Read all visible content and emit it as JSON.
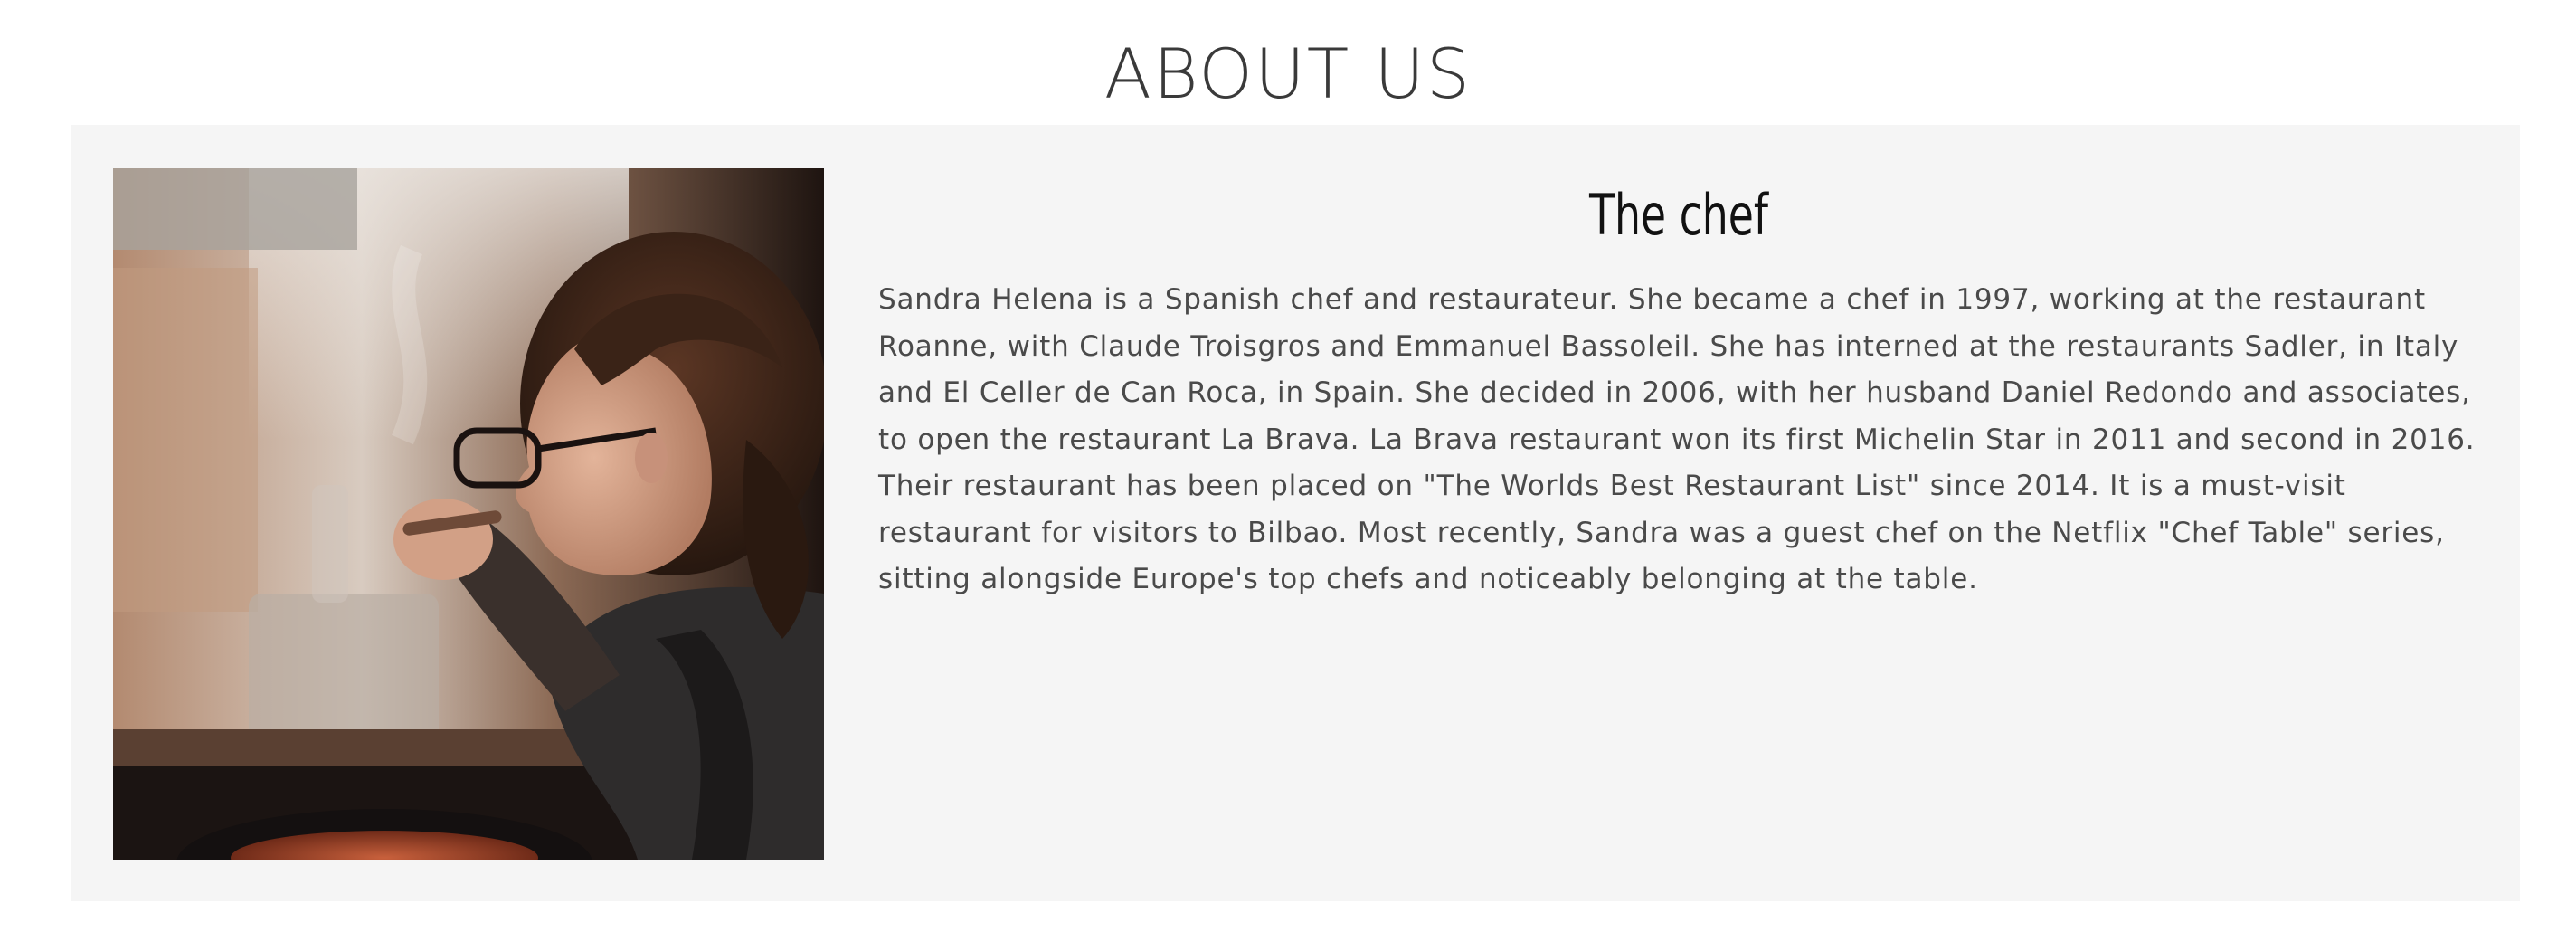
{
  "page": {
    "title": "ABOUT US"
  },
  "about": {
    "heading": "The chef",
    "bio": "Sandra Helena is a Spanish chef and restaurateur. She became a chef in 1997, working at the restaurant Roanne, with Claude Troisgros and Emmanuel Bassoleil. She has interned at the restaurants Sadler, in Italy and El Celler de Can Roca, in Spain. She decided in 2006, with her husband Daniel Redondo and associates, to open the restaurant La Brava. La Brava restaurant won its first Michelin Star in 2011 and second in 2016. Their restaurant has been placed on \"The Worlds Best Restaurant List\" since 2014. It is a must-visit restaurant for visitors to Bilbao. Most recently, Sandra was a guest chef on the Netflix \"Chef Table\" series, sitting alongside Europe's top chefs and noticeably belonging at the table.",
    "photo": {
      "icon": "chef-tasting-photo"
    }
  },
  "colors": {
    "panel_background": "#f5f5f5",
    "title_text": "#3a3a3a",
    "heading_text": "#111111",
    "body_text": "#4a4a4a"
  }
}
